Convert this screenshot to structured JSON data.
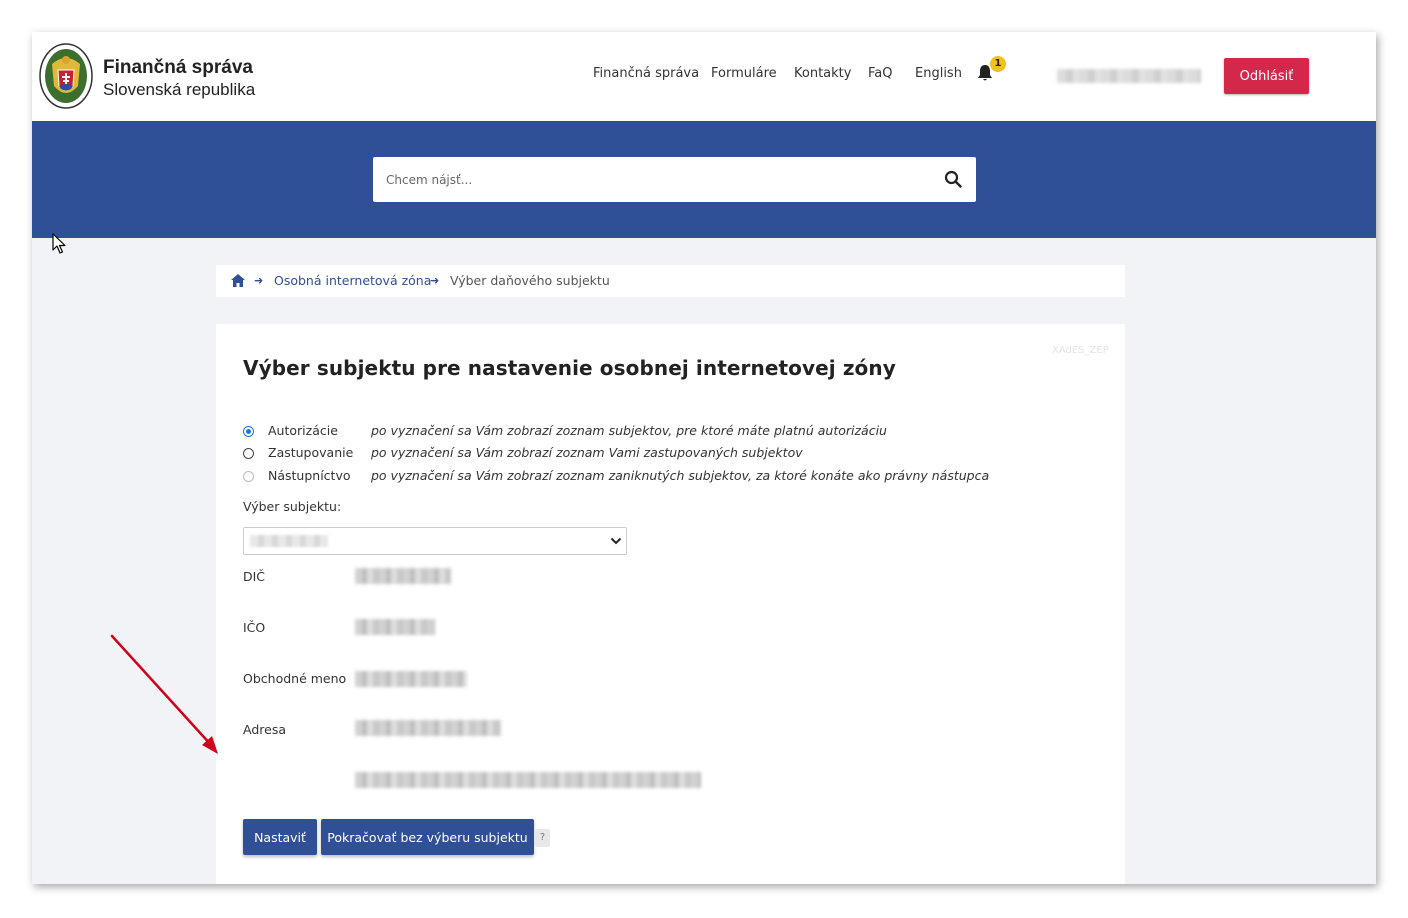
{
  "header": {
    "brand_line1": "Finančná správa",
    "brand_line2": "Slovenská republika",
    "nav": [
      "Finančná správa",
      "Formuláre",
      "Kontakty",
      "FaQ",
      "English"
    ],
    "notification_count": "1",
    "logout_label": "Odhlásiť"
  },
  "search": {
    "placeholder": "Chcem nájsť..."
  },
  "breadcrumb": {
    "items": [
      "Osobná internetová zóna",
      "Výber daňového subjektu"
    ]
  },
  "card": {
    "ghost_text": "XAdES_ZEP",
    "title": "Výber subjektu pre nastavenie osobnej internetovej zóny",
    "options": [
      {
        "label": "Autorizácie",
        "description": "po vyznačení sa Vám zobrazí zoznam subjektov, pre ktoré máte platnú autorizáciu",
        "state": "checked"
      },
      {
        "label": "Zastupovanie",
        "description": "po vyznačení sa Vám zobrazí zoznam Vami zastupovaných subjektov",
        "state": "unchecked"
      },
      {
        "label": "Nástupníctvo",
        "description": "po vyznačení sa Vám zobrazí zoznam zaniknutých subjektov, za ktoré konáte ako právny nástupca",
        "state": "disabled"
      }
    ],
    "select_label": "Výber subjektu:",
    "fields": [
      "DIČ",
      "IČO",
      "Obchodné meno",
      "Adresa"
    ],
    "set_button": "Nastaviť",
    "continue_button": "Pokračovať bez výberu subjektu",
    "help": "?"
  },
  "colors": {
    "brand_blue": "#2f4f97",
    "logout_red": "#d4284a",
    "badge_yellow": "#f2c11b",
    "annotation_red": "#d0021b"
  },
  "icons": [
    "coat-of-arms-logo",
    "bell-icon",
    "search-icon",
    "home-icon",
    "arrow-right-icon",
    "chevron-down-icon",
    "mouse-cursor",
    "annotation-arrow"
  ]
}
